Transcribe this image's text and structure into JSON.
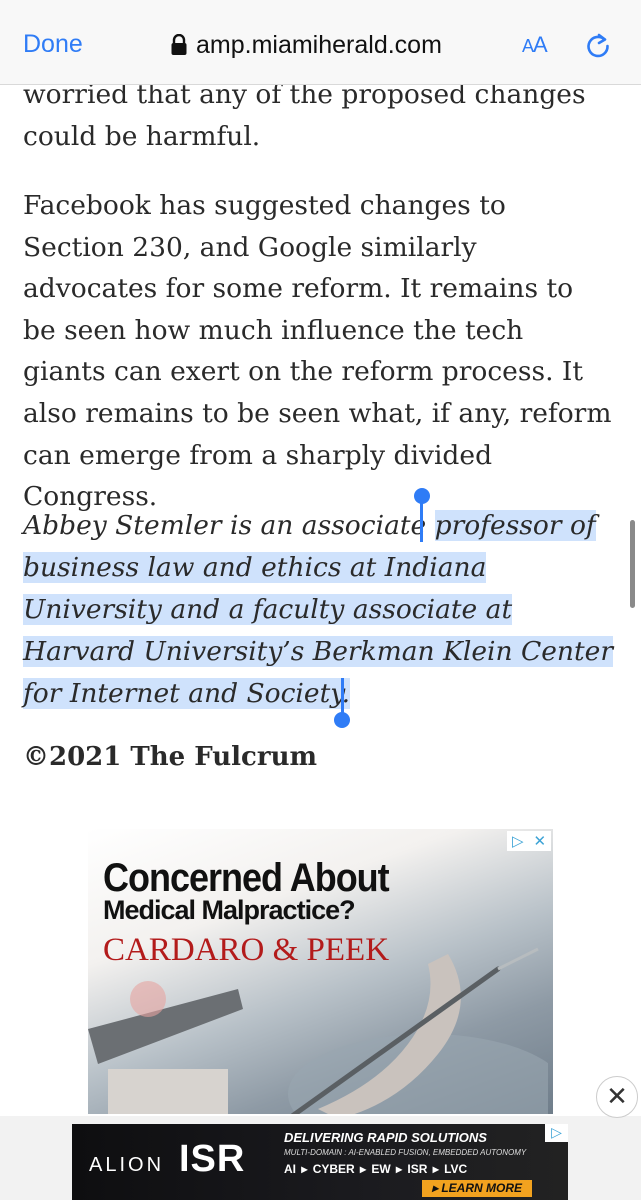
{
  "browser": {
    "done_label": "Done",
    "url": "amp.miamiherald.com",
    "text_size_label_a_small": "A",
    "text_size_label_a_large": "A",
    "lock_icon": "lock-icon",
    "reload_icon": "reload-icon"
  },
  "article": {
    "para1": "worried that any of the proposed changes could be harmful.",
    "para2": "Facebook has suggested changes to Section 230, and Google similarly advocates for some reform. It remains to be seen how much influence the tech giants can exert on the reform process. It also remains to be seen what, if any, reform can emerge from a sharply divided Congress.",
    "bio_unselected": "Abbey Stemler is an associate ",
    "bio_selected": "professor of business law and ethics at Indiana University and a faculty associate at Harvard University’s Berkman Klein Center for Internet and Society.",
    "copyright": "©2021 The Fulcrum"
  },
  "ad_top": {
    "line1": "Concerned About",
    "line2": "Medical Malpractice?",
    "line3": "CARDARO & PEEK",
    "adchoices_icon": "adchoices-icon",
    "close_symbol": "✕"
  },
  "ad_bottom": {
    "brand1": "ALION",
    "brand2": "ISR",
    "headline": "DELIVERING RAPID SOLUTIONS",
    "subline": "MULTI-DOMAIN : AI-ENABLED FUSION, EMBEDDED AUTONOMY",
    "services": "AI ▸ CYBER ▸ EW ▸ ISR ▸ LVC",
    "cta": "▸ LEARN MORE"
  },
  "colors": {
    "accent": "#2f7cf6",
    "selection": "#cfe2fc",
    "ad_red": "#b31b1b",
    "ad_orange": "#f2a21f"
  }
}
